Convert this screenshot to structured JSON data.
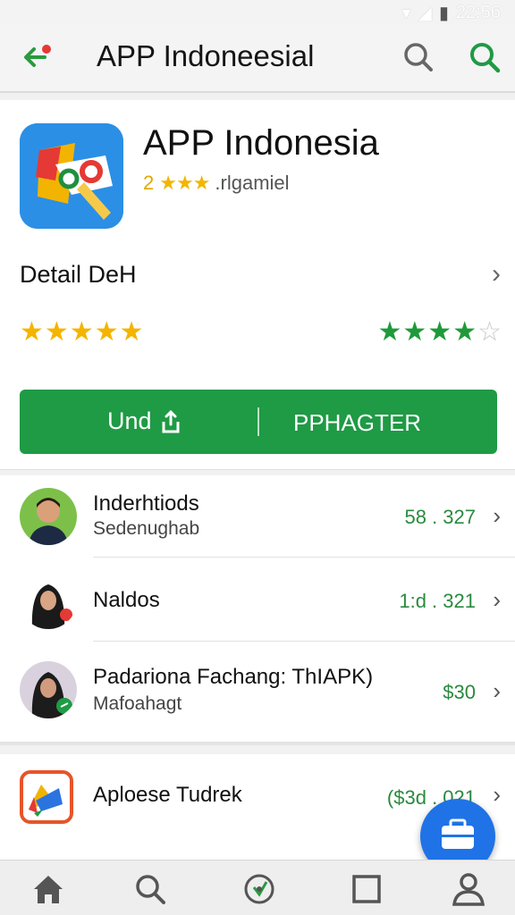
{
  "status": {
    "time": "22:56"
  },
  "app_bar": {
    "title": "APP Indoneesial"
  },
  "app": {
    "name": "APP Indonesia",
    "rating_number": "2",
    "rating_stars_text": "★★★",
    "rating_suffix": ".rlgamiel"
  },
  "detail": {
    "label": "Detail DeH"
  },
  "ratings": {
    "left_stars": 5,
    "right_stars": 4,
    "right_total": 5
  },
  "action": {
    "left_label": "Und",
    "right_label": "PPHAGTER"
  },
  "list": [
    {
      "title": "Inderhtiods",
      "subtitle": "Sedenughab",
      "value": "58 . 327"
    },
    {
      "title": "Naldos",
      "subtitle": "",
      "value": "1:d . 321"
    },
    {
      "title": "Padariona Fachang: ThIAPK)",
      "subtitle": "Mafoahagt",
      "value": "$30"
    }
  ],
  "bottom_item": {
    "title": "Aploese Tudrek",
    "value": "($3d . 021"
  },
  "colors": {
    "accent_green": "#1f9a45",
    "star_yellow": "#f4b400",
    "fab_blue": "#1f73e6"
  },
  "icons": [
    "back-arrow-icon",
    "search-icon",
    "home-icon",
    "compass-icon",
    "square-icon",
    "profile-icon",
    "briefcase-icon"
  ]
}
